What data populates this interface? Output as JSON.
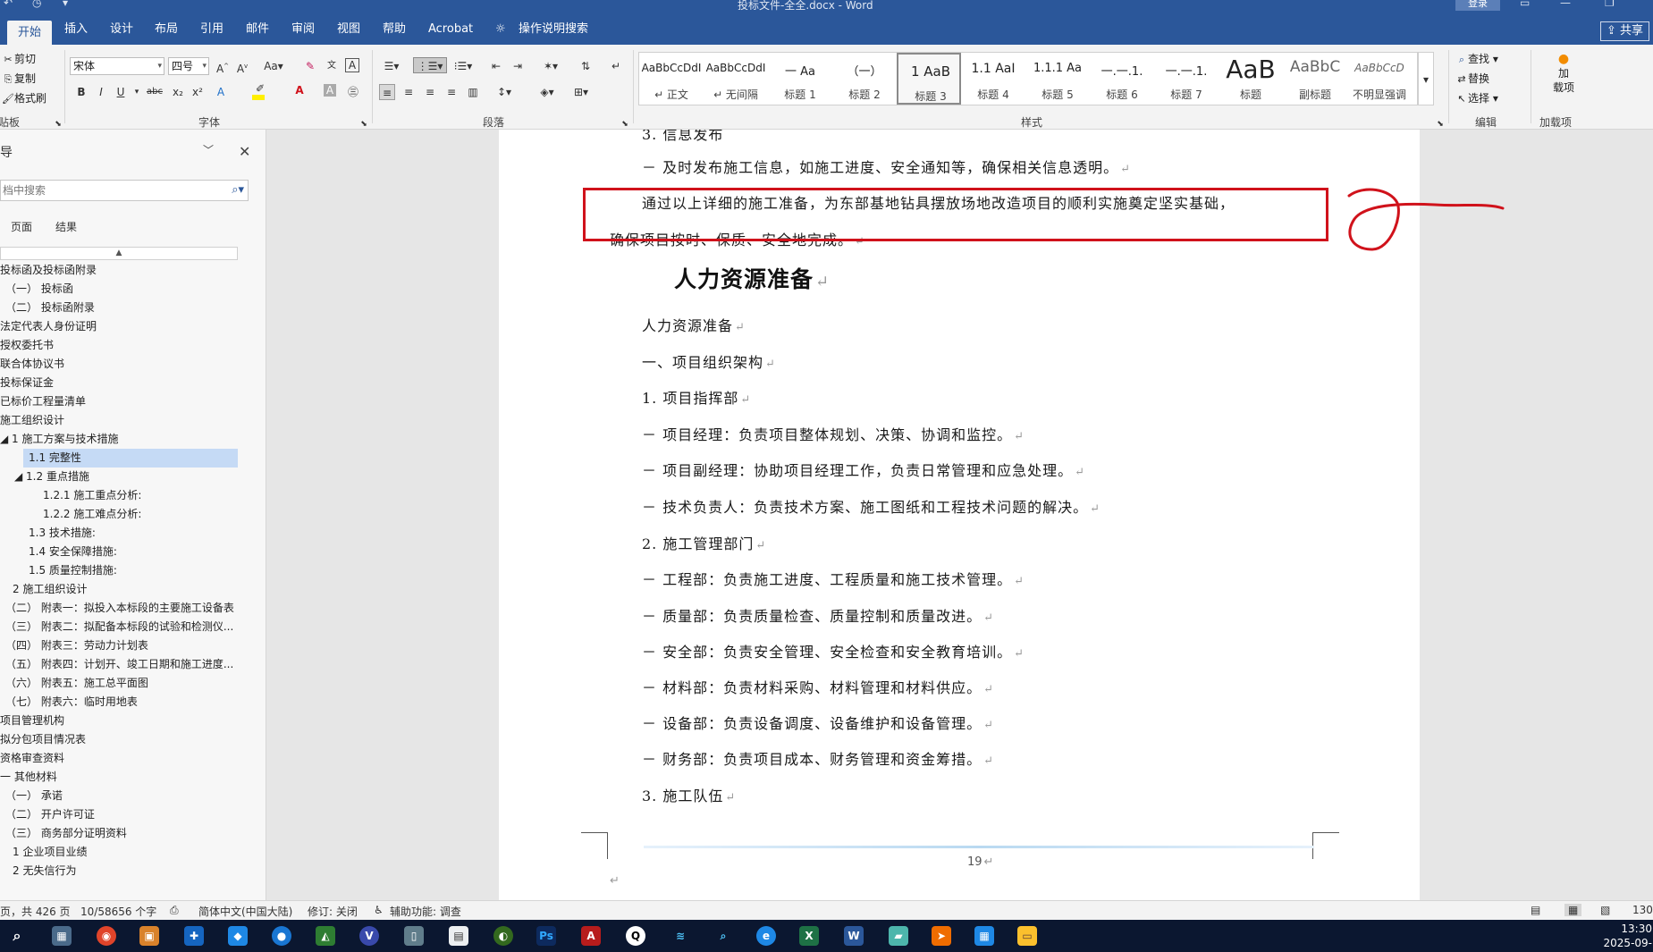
{
  "app": {
    "doc_title": "投标文件-全全.docx - Word",
    "login_label": "登录"
  },
  "tabs": [
    {
      "label": "开始"
    },
    {
      "label": "插入"
    },
    {
      "label": "设计"
    },
    {
      "label": "布局"
    },
    {
      "label": "引用"
    },
    {
      "label": "邮件"
    },
    {
      "label": "审阅"
    },
    {
      "label": "视图"
    },
    {
      "label": "帮助"
    },
    {
      "label": "Acrobat"
    },
    {
      "label": "操作说明搜索"
    }
  ],
  "share_label": "共享",
  "clipboard": {
    "cut": "剪切",
    "copy": "复制",
    "format_painter": "格式刷",
    "group": "剪贴板"
  },
  "font": {
    "name": "宋体",
    "size": "四号",
    "group": "字体"
  },
  "paragraph": {
    "group": "段落"
  },
  "styles_group": "样式",
  "styles": [
    {
      "preview": "AaBbCcDdI",
      "name": "↵ 正文"
    },
    {
      "preview": "AaBbCcDdI",
      "name": "↵ 无间隔"
    },
    {
      "preview": "一 Aa",
      "name": "标题 1"
    },
    {
      "preview": "（一）",
      "name": "标题 2"
    },
    {
      "preview": "1 AaB",
      "name": "标题 3"
    },
    {
      "preview": "1.1 AaI",
      "name": "标题 4"
    },
    {
      "preview": "1.1.1 Aa",
      "name": "标题 5"
    },
    {
      "preview": "一.一.1.",
      "name": "标题 6"
    },
    {
      "preview": "一.一.1.",
      "name": "标题 7"
    },
    {
      "preview": "AaB",
      "name": "标题"
    },
    {
      "preview": "AaBbC",
      "name": "副标题"
    },
    {
      "preview": "AaBbCcD",
      "name": "不明显强调"
    }
  ],
  "editing": {
    "find": "查找",
    "replace": "替换",
    "select": "选择",
    "group": "编辑"
  },
  "addins": {
    "label1": "加",
    "label2": "载项",
    "group": "加载项"
  },
  "nav": {
    "title": "导",
    "search_placeholder": "档中搜索",
    "tab_pages": "页面",
    "tab_results": "结果",
    "collapse": "▲",
    "items": [
      {
        "text": "投标函及投标函附录"
      },
      {
        "text": "（一） 投标函"
      },
      {
        "text": "（二） 投标函附录"
      },
      {
        "text": "法定代表人身份证明"
      },
      {
        "text": "授权委托书"
      },
      {
        "text": "联合体协议书"
      },
      {
        "text": "投标保证金"
      },
      {
        "text": "已标价工程量清单"
      },
      {
        "text": "施工组织设计"
      },
      {
        "text": "◢ 1 施工方案与技术措施"
      },
      {
        "text": "1.1 完整性"
      },
      {
        "text": "◢ 1.2 重点措施"
      },
      {
        "text": "1.2.1 施工重点分析:"
      },
      {
        "text": "1.2.2 施工难点分析:"
      },
      {
        "text": "1.3 技术措施:"
      },
      {
        "text": "1.4 安全保障措施:"
      },
      {
        "text": "1.5 质量控制措施:"
      },
      {
        "text": "2 施工组织设计"
      },
      {
        "text": "（二） 附表一：拟投入本标段的主要施工设备表"
      },
      {
        "text": "（三） 附表二：拟配备本标段的试验和检测仪..."
      },
      {
        "text": "（四） 附表三：劳动力计划表"
      },
      {
        "text": "（五） 附表四：计划开、竣工日期和施工进度..."
      },
      {
        "text": "（六） 附表五：施工总平面图"
      },
      {
        "text": "（七） 附表六：临时用地表"
      },
      {
        "text": "项目管理机构"
      },
      {
        "text": "拟分包项目情况表"
      },
      {
        "text": "资格审查资料"
      },
      {
        "text": "一 其他材料"
      },
      {
        "text": "（一） 承诺"
      },
      {
        "text": "（二） 开户许可证"
      },
      {
        "text": "（三） 商务部分证明资料"
      },
      {
        "text": "1 企业项目业绩"
      },
      {
        "text": "2 无失信行为"
      }
    ]
  },
  "doc": {
    "top_partial": "3. 信息发布",
    "lines": [
      "－ 及时发布施工信息，如施工进度、安全通知等，确保相关信息透明。",
      "通过以上详细的施工准备，为东部基地钻具摆放场地改造项目的顺利实施奠定坚实基础，",
      "确保项目按时、保质、安全地完成。",
      "人力资源准备",
      "一、项目组织架构",
      "1.  项目指挥部",
      "－ 项目经理：负责项目整体规划、决策、协调和监控。",
      "－ 项目副经理：协助项目经理工作，负责日常管理和应急处理。",
      "－ 技术负责人：负责技术方案、施工图纸和工程技术问题的解决。",
      "2.  施工管理部门",
      "－ 工程部：负责施工进度、工程质量和施工技术管理。",
      "－ 质量部：负责质量检查、质量控制和质量改进。",
      "－ 安全部：负责安全管理、安全检查和安全教育培训。",
      "－ 材料部：负责材料采购、材料管理和材料供应。",
      "－ 设备部：负责设备调度、设备维护和设备管理。",
      "－ 财务部：负责项目成本、财务管理和资金筹措。",
      "3.  施工队伍"
    ],
    "heading": "人力资源准备",
    "para_mark": "↵",
    "page_number": "19"
  },
  "status": {
    "page": "页，共 426 页",
    "words": "10/58656 个字",
    "lang": "简体中文(中国大陆)",
    "track": "修订: 关闭",
    "access": "辅助功能: 调查",
    "zoom": "130"
  },
  "clock": {
    "time": "13:30",
    "date": "2025-09-"
  },
  "colors": {
    "brand": "#2b579a",
    "annotation": "#d0121b"
  }
}
